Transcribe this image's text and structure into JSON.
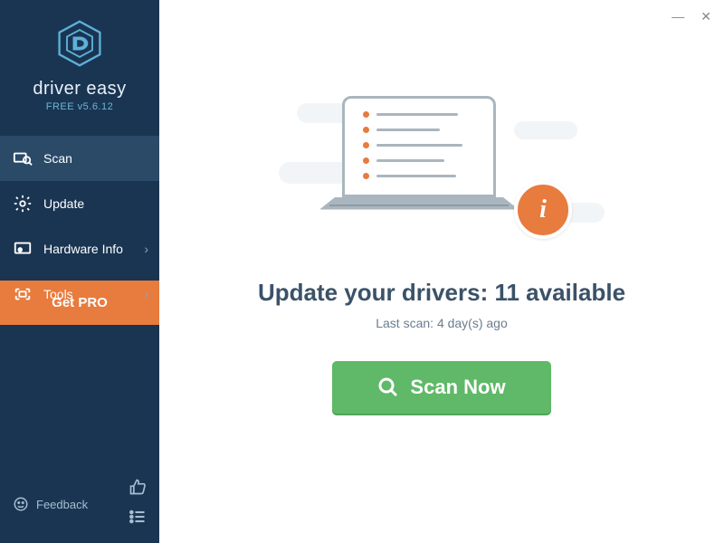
{
  "brand": "driver easy",
  "version": "FREE v5.6.12",
  "nav": {
    "scan": "Scan",
    "update": "Update",
    "hardware": "Hardware Info",
    "tools": "Tools"
  },
  "getpro_label": "Get PRO",
  "feedback_label": "Feedback",
  "main": {
    "headline": "Update your drivers: 11 available",
    "subtext": "Last scan: 4 day(s) ago",
    "scan_button": "Scan Now"
  },
  "colors": {
    "sidebar": "#1a3552",
    "accent_orange": "#e87b3e",
    "accent_green": "#5fb968",
    "text_dark": "#3b5268"
  }
}
